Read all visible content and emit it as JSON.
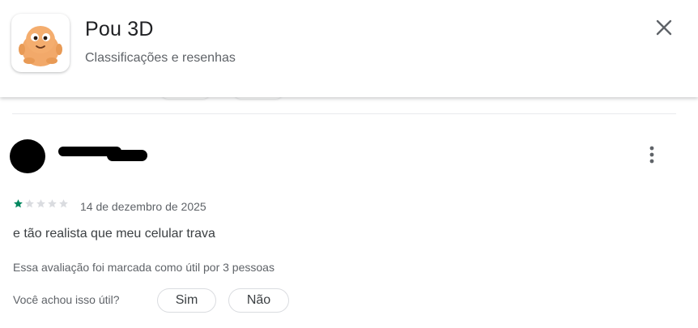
{
  "header": {
    "app_name": "Pou 3D",
    "subtitle": "Classificações e resenhas",
    "close_icon": "close-icon",
    "app_icon": "pou-app-icon"
  },
  "review": {
    "rating": 1,
    "rating_max": 5,
    "star_filled_color": "#01875f",
    "star_empty_color": "#dadce0",
    "date": "14 de dezembro de 2025",
    "text": "e tão realista que meu celular trava",
    "helpful_count_text": "Essa avaliação foi marcada como útil por 3 pessoas",
    "helpful_question": "Você achou isso útil?",
    "yes_label": "Sim",
    "no_label": "Não",
    "more_icon": "more-vert-icon"
  }
}
